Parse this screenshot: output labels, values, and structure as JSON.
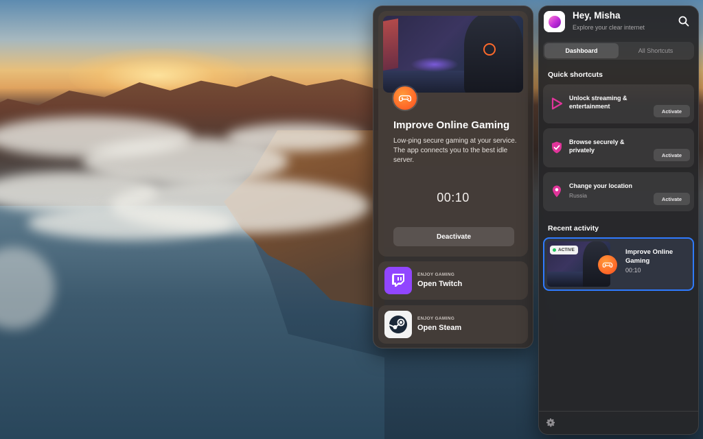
{
  "feature": {
    "title": "Improve Online Gaming",
    "description": "Low-ping secure gaming at your service. The app connects you to the best idle server.",
    "timer": "00:10",
    "deactivate_label": "Deactivate"
  },
  "apps": [
    {
      "kicker": "ENJOY GAMING",
      "name": "Open Twitch",
      "icon": "twitch-icon"
    },
    {
      "kicker": "ENJOY GAMING",
      "name": "Open Steam",
      "icon": "steam-icon"
    }
  ],
  "main": {
    "greeting": "Hey, Misha",
    "subtitle": "Explore your clear internet",
    "tabs": [
      {
        "label": "Dashboard",
        "active": true
      },
      {
        "label": "All Shortcuts",
        "active": false
      }
    ],
    "quick_shortcuts_title": "Quick shortcuts",
    "shortcuts": [
      {
        "label": "Unlock streaming & entertainment",
        "sub": "",
        "icon": "play-icon",
        "action": "Activate"
      },
      {
        "label": "Browse securely & privately",
        "sub": "",
        "icon": "shield-check-icon",
        "action": "Activate"
      },
      {
        "label": "Change your location",
        "sub": "Russia",
        "icon": "location-pin-icon",
        "action": "Activate"
      }
    ],
    "recent_activity_title": "Recent activity",
    "recent": {
      "status": "ACTIVE",
      "title": "Improve Online Gaming",
      "time": "00:10"
    }
  },
  "colors": {
    "accent_pink": "#e0359a",
    "accent_orange": "#ff5a24",
    "selection_blue": "#2f7bff",
    "twitch_purple": "#9146ff",
    "active_green": "#22c55e"
  }
}
